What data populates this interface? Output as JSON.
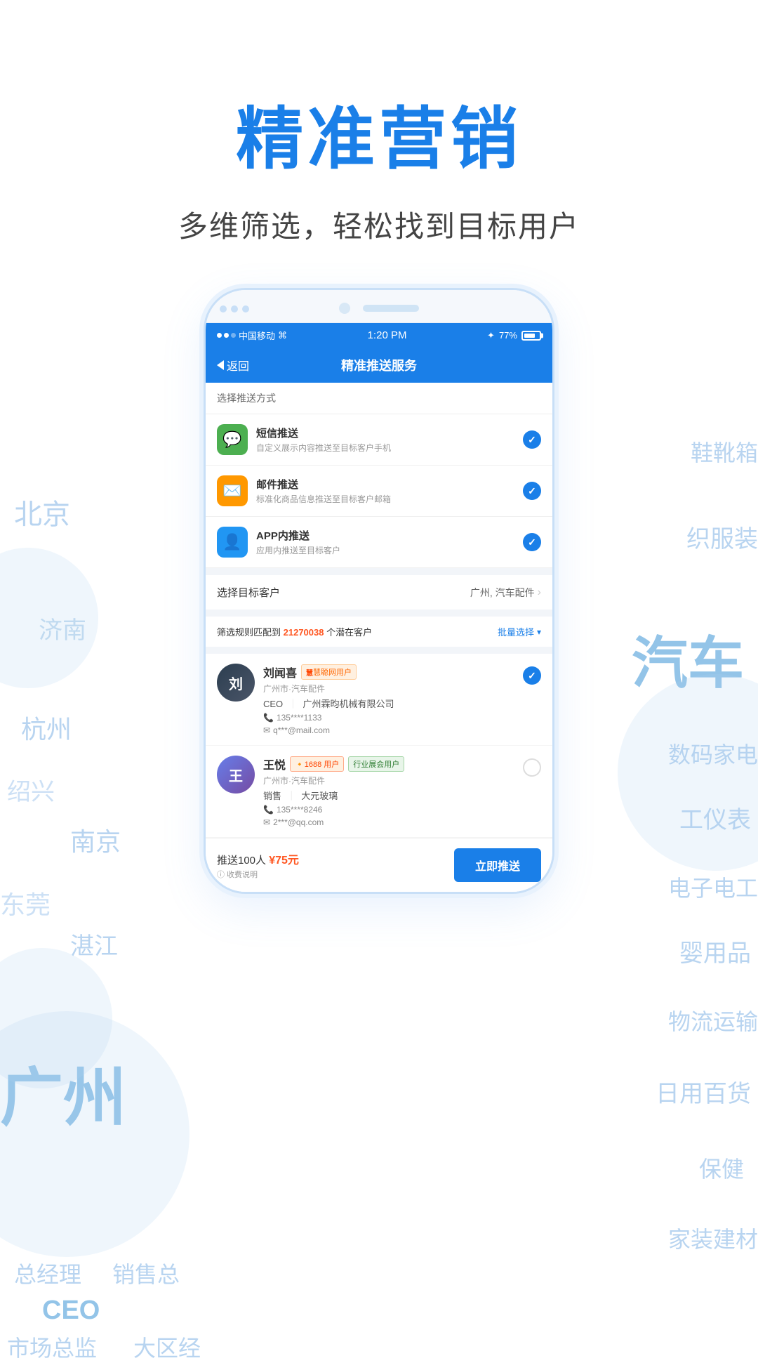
{
  "header": {
    "main_title": "精准营销",
    "sub_title": "多维筛选，轻松找到目标用户"
  },
  "bg_tags": {
    "left": [
      "北京",
      "济南",
      "杭州",
      "绍兴",
      "南京",
      "东莞",
      "湛江",
      "广州",
      "总经理",
      "销售总",
      "CEO",
      "市场总监",
      "大区经"
    ],
    "right": [
      "鞋靴箱",
      "织服装",
      "汽车",
      "数码家电",
      "工仪表",
      "电子电工",
      "婴用品",
      "物流运输",
      "日用百货",
      "保健",
      "家装建材"
    ]
  },
  "status_bar": {
    "carrier": "中国移动",
    "time": "1:20 PM",
    "bluetooth": "♦",
    "battery": "77%"
  },
  "nav": {
    "back_label": "返回",
    "title": "精准推送服务"
  },
  "section_push": {
    "label": "选择推送方式"
  },
  "push_methods": [
    {
      "id": "sms",
      "name": "短信推送",
      "desc": "自定义展示内容推送至目标客户手机",
      "icon": "💬",
      "checked": true,
      "color": "#4CAF50"
    },
    {
      "id": "mail",
      "name": "邮件推送",
      "desc": "标准化商品信息推送至目标客户邮箱",
      "icon": "✉️",
      "checked": true,
      "color": "#FF9800"
    },
    {
      "id": "app",
      "name": "APP内推送",
      "desc": "应用内推送至目标客户",
      "icon": "👤",
      "checked": true,
      "color": "#2196F3"
    }
  ],
  "target_customer": {
    "label": "选择目标客户",
    "value": "广州, 汽车配件"
  },
  "filter": {
    "prefix_text": "筛选规则匹配到",
    "count": "21270038",
    "suffix_text": "个潜在客户",
    "batch_select": "批量选择"
  },
  "customers": [
    {
      "name": "刘闻喜",
      "badge": "慧聪网用户",
      "location": "广州市·汽车配件",
      "role": "CEO",
      "company": "广州霖昀机械有限公司",
      "phone": "135****1133",
      "email": "q***@mail.com",
      "checked": true,
      "avatar_initial": "刘",
      "avatar_style": "male"
    },
    {
      "name": "王悦",
      "badge_1": "1688 用户",
      "badge_2": "行业展会用户",
      "location": "广州市·汽车配件",
      "role": "销售",
      "company": "大元玻璃",
      "phone": "135****8246",
      "email": "2***@qq.com",
      "checked": false,
      "avatar_initial": "王",
      "avatar_style": "female"
    }
  ],
  "bottom_bar": {
    "push_count_label": "推送100人",
    "price": "¥75元",
    "price_note": "收费说明",
    "send_btn": "立即推送"
  }
}
